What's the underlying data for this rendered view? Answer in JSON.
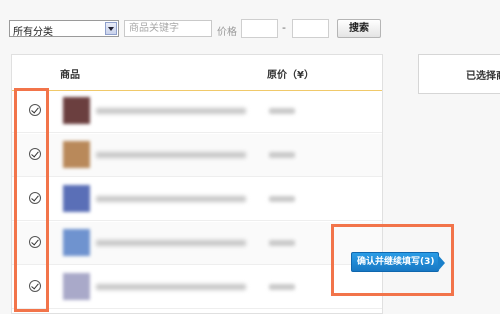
{
  "filter": {
    "category_value": "所有分类",
    "keyword_placeholder": "商品关键字",
    "price_label": "价格",
    "price_separator": "-",
    "search_label": "搜索"
  },
  "table": {
    "col_product": "商品",
    "col_price": "原价（¥）",
    "rows": [
      {
        "selected": true,
        "thumb_color": "#6b3f3f"
      },
      {
        "selected": true,
        "thumb_color": "#b9895a"
      },
      {
        "selected": true,
        "thumb_color": "#5a6fb7"
      },
      {
        "selected": true,
        "thumb_color": "#6f93cf"
      },
      {
        "selected": true,
        "thumb_color": "#a9a9c9"
      }
    ]
  },
  "selected_panel": {
    "title": "已选择商品"
  },
  "confirm_button": {
    "label": "确认并继续填写(3)"
  },
  "colors": {
    "highlight": "#f2744a",
    "confirm_bg": "#1e88d6",
    "header_rule": "#f0c96a"
  }
}
